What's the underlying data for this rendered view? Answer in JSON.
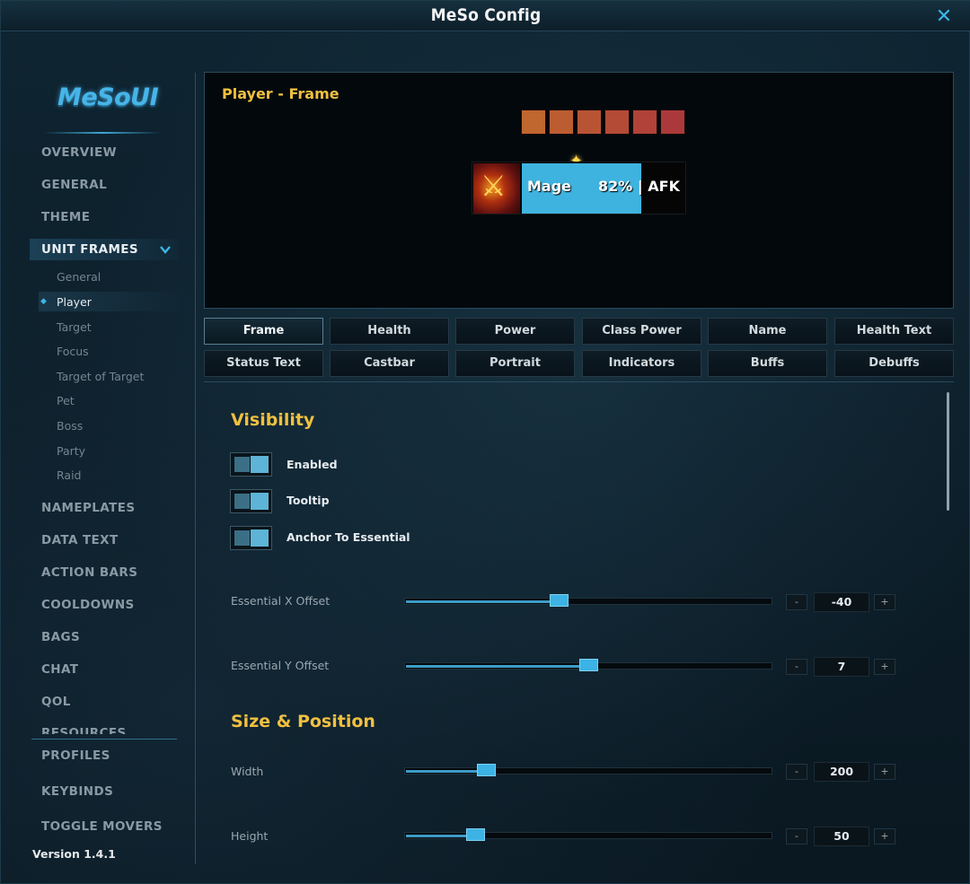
{
  "window": {
    "title": "MeSo Config"
  },
  "sidebar": {
    "logo": "MeSoUI",
    "nav": [
      "OVERVIEW",
      "GENERAL",
      "THEME",
      "UNIT FRAMES",
      "NAMEPLATES",
      "DATA TEXT",
      "ACTION BARS",
      "COOLDOWNS",
      "BAGS",
      "CHAT",
      "QOL",
      "RESOURCES"
    ],
    "active_nav": "UNIT FRAMES",
    "unit_frames_sub": [
      "General",
      "Player",
      "Target",
      "Focus",
      "Target of Target",
      "Pet",
      "Boss",
      "Party",
      "Raid"
    ],
    "active_sub": "Player",
    "bottom": [
      "PROFILES",
      "KEYBINDS",
      "TOGGLE MOVERS"
    ],
    "version": "Version 1.4.1"
  },
  "preview": {
    "title": "Player - Frame",
    "class_power_colors": [
      "#c0662f",
      "#bc5d31",
      "#b85434",
      "#b44b36",
      "#b04239",
      "#ab393b"
    ],
    "unit_name": "Mage",
    "health_text": "82% | AFK",
    "health_color": "#3fb3df",
    "icons": {
      "portrait": "fire-sword-icon",
      "leader": "star-icon"
    }
  },
  "tabs": [
    "Frame",
    "Health",
    "Power",
    "Class Power",
    "Name",
    "Health Text",
    "Status Text",
    "Castbar",
    "Portrait",
    "Indicators",
    "Buffs",
    "Debuffs"
  ],
  "active_tab": "Frame",
  "visibility": {
    "title": "Visibility",
    "toggles": [
      "Enabled",
      "Tooltip",
      "Anchor To Essential"
    ],
    "sliders": [
      {
        "label": "Essential X Offset",
        "value": "-40",
        "fraction": 0.42
      },
      {
        "label": "Essential Y Offset",
        "value": "7",
        "fraction": 0.5
      }
    ]
  },
  "size_position": {
    "title": "Size & Position",
    "sliders": [
      {
        "label": "Width",
        "value": "200",
        "fraction": 0.22
      },
      {
        "label": "Height",
        "value": "50",
        "fraction": 0.19
      }
    ]
  },
  "stepper": {
    "minus": "-",
    "plus": "+"
  },
  "colors": {
    "accent": "#3cb6e6",
    "heading": "#f0c040"
  }
}
